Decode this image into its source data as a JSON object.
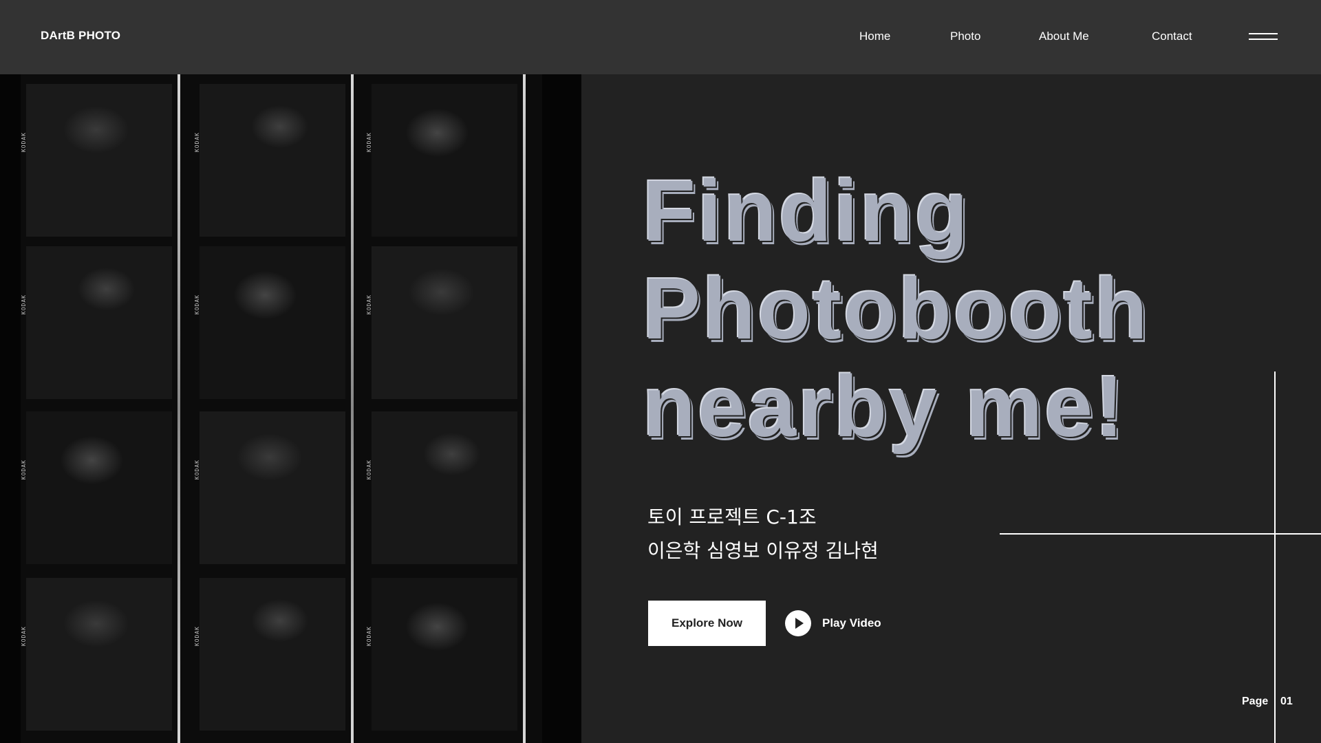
{
  "header": {
    "logo": "DArtB PHOTO",
    "nav": [
      {
        "label": "Home"
      },
      {
        "label": "Photo"
      },
      {
        "label": "About Me"
      },
      {
        "label": "Contact"
      }
    ],
    "menu_icon": "hamburger-menu-icon"
  },
  "contact_sheet": {
    "film_marker": "KODAK",
    "frames": 12,
    "style": "black-and-white photobooth film strips"
  },
  "hero": {
    "title_lines": [
      "Finding",
      "Photobooth",
      "nearby me!"
    ],
    "subtitle_lines": [
      "토이 프로젝트 C-1조",
      "이은학 심영보 이유정 김나현"
    ]
  },
  "cta": {
    "explore_label": "Explore Now",
    "play_label": "Play Video",
    "play_icon": "play-circle-icon"
  },
  "pagination": {
    "label": "Page",
    "current": "01"
  },
  "colors": {
    "background": "#222222",
    "navbar": "#333333",
    "title": "#a8aebd",
    "text": "#ffffff"
  }
}
